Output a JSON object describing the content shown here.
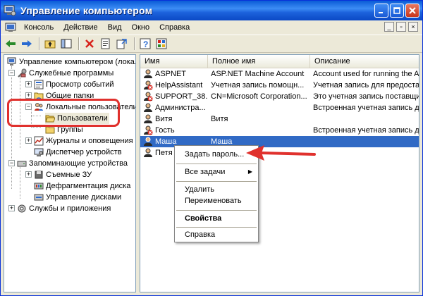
{
  "window": {
    "title": "Управление компьютером"
  },
  "menubar": {
    "items": [
      "Консоль",
      "Действие",
      "Вид",
      "Окно",
      "Справка"
    ]
  },
  "toolbar": {
    "icons": [
      "back-icon",
      "forward-icon",
      "up-icon",
      "show-tree-icon",
      "delete-icon",
      "properties-icon",
      "export-icon",
      "help-icon",
      "mmc-icon"
    ]
  },
  "tree": {
    "root": "Управление компьютером (локал",
    "utilities": "Служебные программы",
    "event_viewer": "Просмотр событий",
    "shared_folders": "Общие папки",
    "local_users": "Локальные пользователи",
    "users": "Пользователи",
    "groups": "Группы",
    "perf_logs": "Журналы и оповещения пр",
    "device_manager": "Диспетчер устройств",
    "storage": "Запоминающие устройства",
    "removable": "Съемные ЗУ",
    "defrag": "Дефрагментация диска",
    "disk_mgmt": "Управление дисками",
    "services": "Службы и приложения"
  },
  "list": {
    "columns": [
      "Имя",
      "Полное имя",
      "Описание"
    ],
    "rows": [
      {
        "name": "ASPNET",
        "full": "ASP.NET Machine Account",
        "desc": "Account used for running the ASP.N"
      },
      {
        "name": "HelpAssistant",
        "full": "Учетная запись помощн...",
        "desc": "Учетная запись для предоставлен"
      },
      {
        "name": "SUPPORT_38...",
        "full": "CN=Microsoft Corporation...",
        "desc": "Это учетная запись поставщика с"
      },
      {
        "name": "Администра...",
        "full": "",
        "desc": "Встроенная учетная запись для ад"
      },
      {
        "name": "Витя",
        "full": "Витя",
        "desc": ""
      },
      {
        "name": "Гость",
        "full": "",
        "desc": "Встроенная учетная запись для д"
      },
      {
        "name": "Маша",
        "full": "Маша",
        "desc": ""
      },
      {
        "name": "Петя",
        "full": "",
        "desc": ""
      }
    ]
  },
  "context_menu": {
    "set_password": "Задать пароль...",
    "all_tasks": "Все задачи",
    "delete": "Удалить",
    "rename": "Переименовать",
    "properties": "Свойства",
    "help": "Справка"
  },
  "colors": {
    "titlebar": "#0a5bd6",
    "selection": "#316ac5",
    "callout": "#e0312d"
  }
}
